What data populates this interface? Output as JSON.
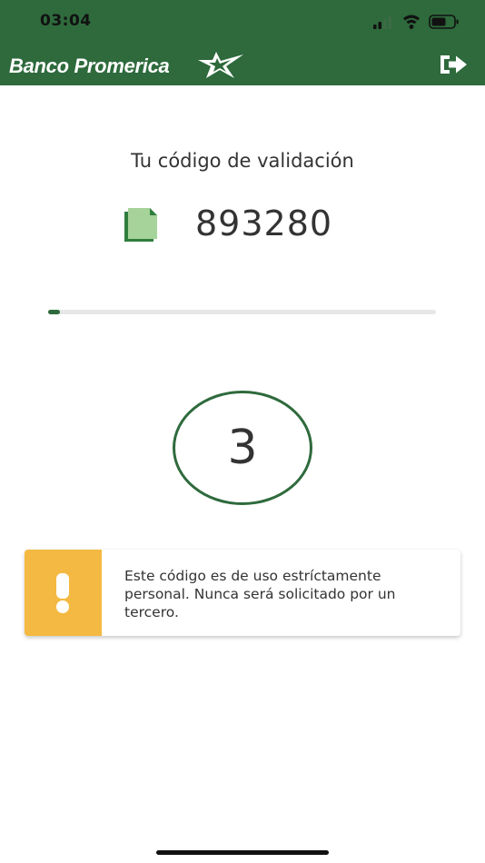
{
  "status_bar": {
    "time": "03:04",
    "icons": [
      "cellular-signal-icon",
      "wifi-icon",
      "battery-icon"
    ]
  },
  "header": {
    "brand_name": "Banco Promerica",
    "brand_icon": "star-icon",
    "logout_icon": "logout-icon",
    "background_color": "#2e6a3c"
  },
  "validation": {
    "title": "Tu código de validación",
    "code": "893280",
    "copy_icon": "copy-icon"
  },
  "timer": {
    "seconds_left": "3",
    "progress_percent": 3,
    "accent_color": "#2e6a3c"
  },
  "notice": {
    "icon": "exclamation-icon",
    "icon_background": "#f4b942",
    "text": "Este código es de uso estríctamente personal. Nunca será solicitado por un tercero."
  }
}
